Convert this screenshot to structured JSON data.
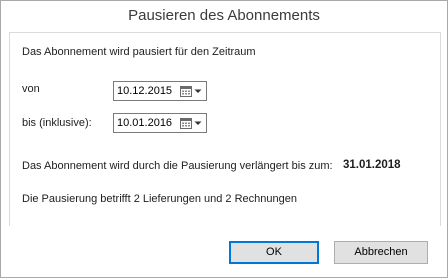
{
  "window": {
    "title": "Pausieren des Abonnements"
  },
  "intro": "Das Abonnement wird pausiert für den Zeitraum",
  "from": {
    "label": "von",
    "value": "10.12.2015"
  },
  "to": {
    "label": "bis (inklusive):",
    "value": "10.01.2016"
  },
  "extension": {
    "label": "Das Abonnement wird durch die Pausierung verlängert bis zum:",
    "date": "31.01.2018"
  },
  "affects": "Die Pausierung betrifft 2 Lieferungen und 2 Rechnungen",
  "buttons": {
    "ok": "OK",
    "cancel": "Abbrechen"
  }
}
